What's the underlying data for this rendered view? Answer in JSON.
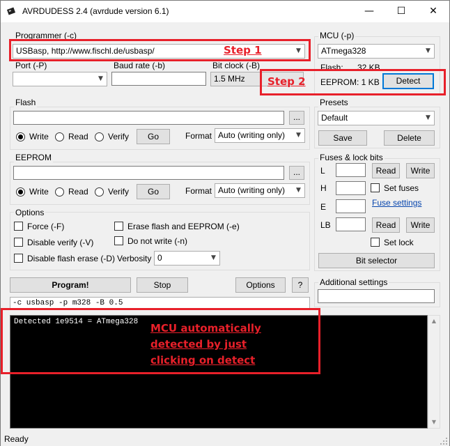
{
  "window": {
    "title": "AVRDUDESS 2.4 (avrdude version 6.1)",
    "minimize_glyph": "—",
    "maximize_glyph": "☐",
    "close_glyph": "✕"
  },
  "programmer": {
    "group_label": "Programmer (-c)",
    "value": "USBasp, http://www.fischl.de/usbasp/",
    "port_label": "Port (-P)",
    "port_value": "",
    "baud_label": "Baud rate (-b)",
    "baud_value": "",
    "bitclock_label": "Bit clock (-B)",
    "bitclock_value": "1.5 MHz"
  },
  "mcu": {
    "group_label": "MCU (-p)",
    "value": "ATmega328",
    "flash_label": "Flash:",
    "flash_value": "32 KB",
    "eeprom_text": "EEPROM: 1 KB",
    "detect_label": "Detect"
  },
  "flash": {
    "group_label": "Flash",
    "path": "",
    "browse_label": "...",
    "write_label": "Write",
    "read_label": "Read",
    "verify_label": "Verify",
    "go_label": "Go",
    "format_label": "Format",
    "format_value": "Auto (writing only)"
  },
  "eeprom": {
    "group_label": "EEPROM",
    "path": "",
    "browse_label": "...",
    "write_label": "Write",
    "read_label": "Read",
    "verify_label": "Verify",
    "go_label": "Go",
    "format_label": "Format",
    "format_value": "Auto (writing only)"
  },
  "options": {
    "group_label": "Options",
    "force": "Force (-F)",
    "disable_verify": "Disable verify (-V)",
    "disable_flash_erase": "Disable flash erase (-D)",
    "erase_flash_eeprom": "Erase flash and EEPROM (-e)",
    "do_not_write": "Do not write (-n)",
    "verbosity_label": "Verbosity",
    "verbosity_value": "0"
  },
  "presets": {
    "group_label": "Presets",
    "value": "Default",
    "save_label": "Save",
    "delete_label": "Delete"
  },
  "fuses": {
    "group_label": "Fuses & lock bits",
    "l_label": "L",
    "h_label": "H",
    "e_label": "E",
    "lb_label": "LB",
    "read_label": "Read",
    "write_label": "Write",
    "set_fuses_label": "Set fuses",
    "fuse_settings_link": "Fuse settings",
    "set_lock_label": "Set lock",
    "bit_selector_label": "Bit selector"
  },
  "actions": {
    "program_label": "Program!",
    "stop_label": "Stop",
    "options_label": "Options",
    "help_label": "?"
  },
  "additional": {
    "group_label": "Additional settings",
    "value": ""
  },
  "command_line": "-c usbasp -p m328 -B 0.5",
  "console": {
    "text": "Detected 1e9514 = ATmega328"
  },
  "status": "Ready",
  "annotations": {
    "step1": "Step 1",
    "step2": "Step 2",
    "note_line1": "MCU automatically",
    "note_line2": "detected by just",
    "note_line3": "clicking on detect",
    "color": "#e8202a"
  }
}
